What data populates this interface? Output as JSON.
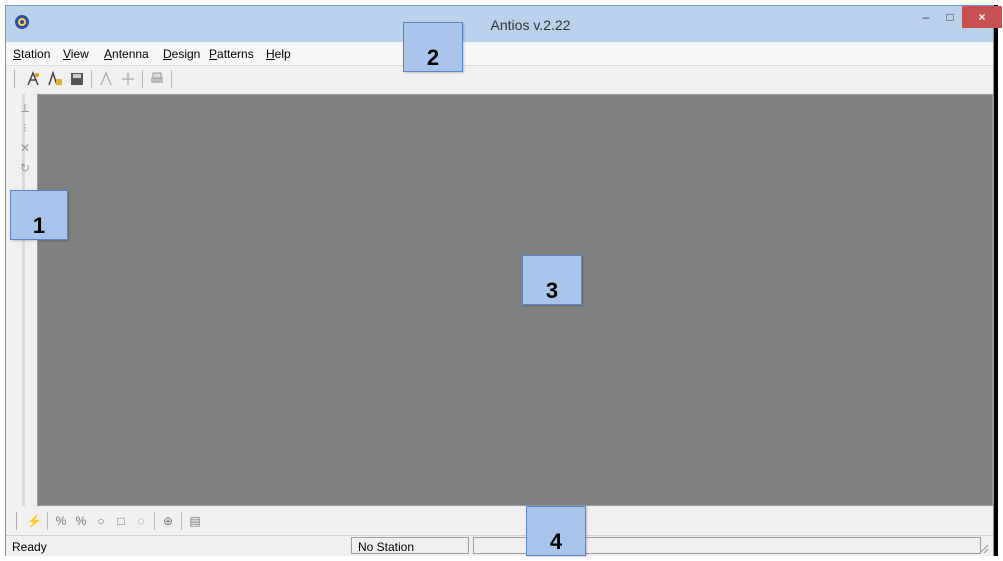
{
  "window": {
    "title": "Antios v.2.22",
    "close_label": "×",
    "min_label": "–",
    "max_label": "□"
  },
  "menubar": {
    "items": [
      {
        "first": "S",
        "rest": "tation"
      },
      {
        "first": "V",
        "rest": "iew"
      },
      {
        "first": "A",
        "rest": "ntenna"
      },
      {
        "first": "D",
        "rest": "esign"
      },
      {
        "first": "P",
        "rest": "atterns"
      },
      {
        "first": "H",
        "rest": "elp"
      }
    ]
  },
  "statusbar": {
    "ready": "Ready",
    "station": "No Station"
  },
  "callouts": {
    "one": "1",
    "two": "2",
    "three": "3",
    "four": "4"
  },
  "colors": {
    "titlebar": "#b9d1ea",
    "workspace": "#808080",
    "close": "#c75050",
    "callout": "#a9c5ec"
  }
}
